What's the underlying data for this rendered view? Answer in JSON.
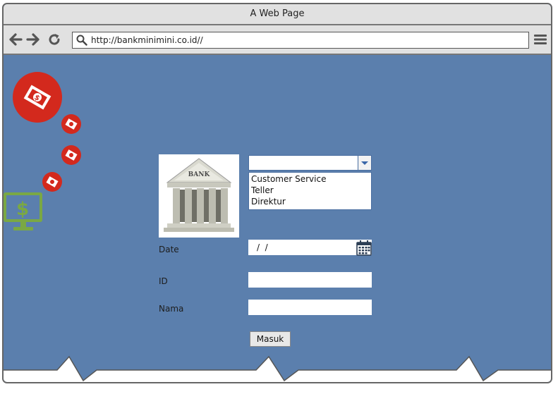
{
  "window": {
    "title": "A Web Page"
  },
  "browser": {
    "url": "http://bankminimini.co.id//",
    "back_icon": "arrow-left-icon",
    "forward_icon": "arrow-right-icon",
    "reload_icon": "reload-icon",
    "menu_icon": "hamburger-menu-icon"
  },
  "decor": {
    "coin_icon": "money-coin-icon",
    "monitor_icon": "dollar-monitor-icon"
  },
  "logo": {
    "text": "BANK"
  },
  "role_select": {
    "value": "",
    "options": [
      "Customer Service",
      "Teller",
      "Direktur"
    ]
  },
  "form": {
    "date_label": "Date",
    "date_value": "/  /",
    "id_label": "ID",
    "id_value": "",
    "nama_label": "Nama",
    "nama_value": "",
    "submit_label": "Masuk"
  },
  "colors": {
    "background": "#5b7fad",
    "coin": "#d3291d",
    "monitor": "#7aa844",
    "chrome": "#e1e1e1"
  }
}
